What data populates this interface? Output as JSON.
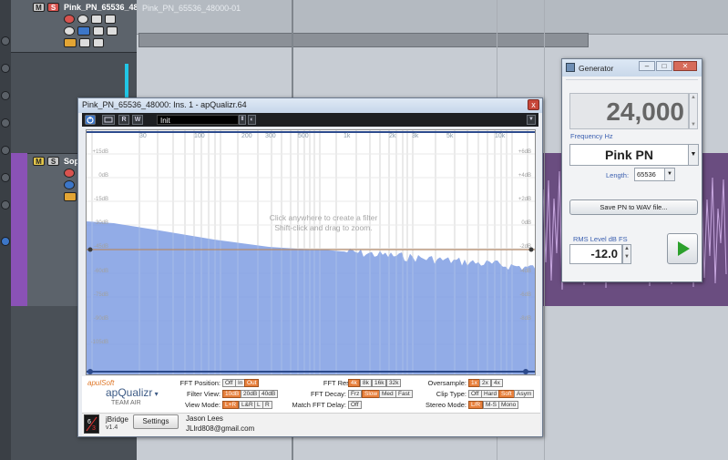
{
  "daw": {
    "track1_name": "Pink_PN_65536_48",
    "track2_name": "Sop",
    "clip_name": "Pink_PN_65536_48000-01",
    "mute_label": "M",
    "solo_label": "S"
  },
  "plugin": {
    "window_title": "Pink_PN_65536_48000: Ins. 1 - apQualizr.64",
    "close_label": "x",
    "toolbar": {
      "preset": "Init",
      "read_label": "R",
      "write_label": "W",
      "power_icon": "power-icon",
      "compare_label": "ab"
    },
    "graph": {
      "hint_line1": "Click anywhere to create a filter",
      "hint_line2": "Shift-click and drag to zoom.",
      "hz_labels": [
        "30",
        "100",
        "200",
        "300",
        "500",
        "1k",
        "2k",
        "3k",
        "5k",
        "10k"
      ],
      "db_labels_left": [
        "+15dB",
        "0dB",
        "-15dB",
        "-30dB",
        "-45dB",
        "-60dB",
        "-75dB",
        "-90dB",
        "-105dB"
      ],
      "db_labels_right": [
        "+6dB",
        "+4dB",
        "+2dB",
        "0dB",
        "-2dB",
        "-4dB",
        "-6dB",
        "-8dB"
      ],
      "colors": {
        "spectrum": "#7f9de3",
        "zero_line": "#b58b6b",
        "grid": "#c9c9c9"
      }
    },
    "logo": {
      "brand_small": "apulSoft",
      "product": "apQualizr",
      "team": "TEAM AIR"
    },
    "controls": {
      "fft_position": {
        "label": "FFT Position:",
        "options": [
          "Off",
          "In",
          "Out"
        ],
        "selected": "Out"
      },
      "filter_view": {
        "label": "Filter View:",
        "options": [
          "10dB",
          "20dB",
          "40dB"
        ],
        "selected": "10dB"
      },
      "view_mode": {
        "label": "View Mode:",
        "options": [
          "L+R",
          "L&R",
          "L",
          "R"
        ],
        "selected": "L+R"
      },
      "fft_res": {
        "label": "FFT Res:",
        "options": [
          "4k",
          "8k",
          "16k",
          "32k"
        ],
        "selected": "4k"
      },
      "fft_decay": {
        "label": "FFT Decay:",
        "options": [
          "Frz",
          "Slow",
          "Med",
          "Fast"
        ],
        "selected": "Slow"
      },
      "match_fft_delay": {
        "label": "Match FFT Delay:",
        "options": [
          "Off"
        ],
        "selected": ""
      },
      "oversample": {
        "label": "Oversample:",
        "options": [
          "1x",
          "2x",
          "4x"
        ],
        "selected": "1x"
      },
      "clip_type": {
        "label": "Clip Type:",
        "options": [
          "Off",
          "Hard",
          "Soft",
          "Asym"
        ],
        "selected": "Soft"
      },
      "stereo_mode": {
        "label": "Stereo Mode:",
        "options": [
          "L/R",
          "M-S",
          "Mono"
        ],
        "selected": "L/R"
      }
    },
    "jbridge": {
      "name": "jBridge",
      "version": "v1.4",
      "settings_label": "Settings",
      "author": "Jason Lees",
      "email": "JLlrd808@gmail.com"
    }
  },
  "generator": {
    "window_title": "Generator",
    "frequency_value": "24,000",
    "frequency_label": "Frequency Hz",
    "noise_type": "Pink PN",
    "length_label": "Length:",
    "length_value": "65536",
    "save_label": "Save PN to WAV file...",
    "rms_label": "RMS Level dB FS",
    "rms_value": "-12.0",
    "play_icon": "play-icon",
    "colors": {
      "label_blue": "#3b5fb0",
      "play_green": "#2ca02c"
    }
  }
}
